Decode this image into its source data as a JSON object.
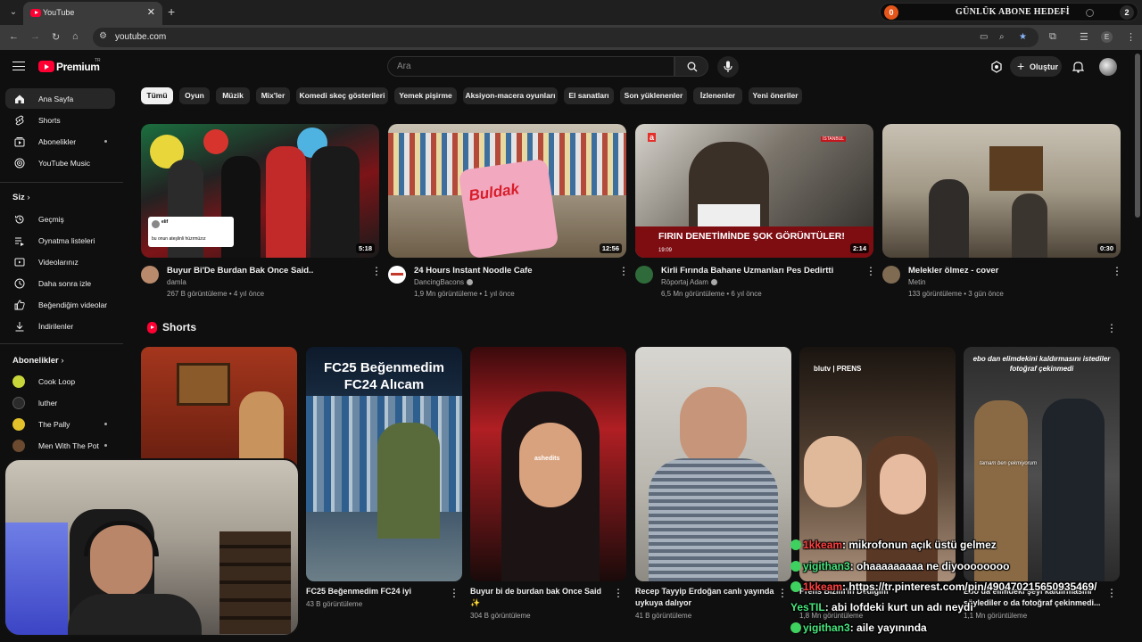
{
  "browser": {
    "tab_title": "YouTube",
    "url": "youtube.com",
    "profile_letter": "E"
  },
  "goal_widget": {
    "left_count": "0",
    "title": "GÜNLÜK ABONE HEDEFİ",
    "right_count": "2"
  },
  "header": {
    "brand": "Premium",
    "brand_sup": "TR",
    "search_placeholder": "Ara",
    "create_label": "Oluştur"
  },
  "sidebar": {
    "main": [
      {
        "label": "Ana Sayfa",
        "icon": "home-icon"
      },
      {
        "label": "Shorts",
        "icon": "shorts-icon"
      },
      {
        "label": "Abonelikler",
        "icon": "subscriptions-icon"
      },
      {
        "label": "YouTube Music",
        "icon": "music-icon"
      }
    ],
    "you_heading": "Siz",
    "you": [
      {
        "label": "Geçmiş",
        "icon": "history-icon"
      },
      {
        "label": "Oynatma listeleri",
        "icon": "playlists-icon"
      },
      {
        "label": "Videolarınız",
        "icon": "your-videos-icon"
      },
      {
        "label": "Daha sonra izle",
        "icon": "watch-later-icon"
      },
      {
        "label": "Beğendiğim videolar",
        "icon": "liked-icon"
      },
      {
        "label": "İndirilenler",
        "icon": "downloads-icon"
      }
    ],
    "subs_heading": "Abonelikler",
    "subs": [
      {
        "label": "Cook Loop",
        "color": "#c8d63a"
      },
      {
        "label": "luther",
        "color": "#2b2b2b"
      },
      {
        "label": "The Pally",
        "color": "#e2c12b"
      },
      {
        "label": "Men With The Pot",
        "color": "#6b4a2f"
      }
    ]
  },
  "chips": [
    "Tümü",
    "Oyun",
    "Müzik",
    "Mix'ler",
    "Komedi skeç gösterileri",
    "Yemek pişirme",
    "Aksiyon-macera oyunları",
    "El sanatları",
    "Son yüklenenler",
    "İzlenenler",
    "Yeni öneriler"
  ],
  "videos": [
    {
      "title": "Buyur Bi'De Burdan Bak Once Said..",
      "channel": "damla",
      "meta": "267 B görüntüleme • 4 yıl önce",
      "duration": "5:18",
      "overlay": "bu onun ateşlinli hüzrmüzız",
      "overlay_user": "elif"
    },
    {
      "title": "24 Hours Instant Noodle Cafe",
      "channel": "DancingBacons",
      "meta": "1,9 Mn görüntüleme • 1 yıl önce",
      "duration": "12:56",
      "overlay": "Buldak"
    },
    {
      "title": "Kirli Fırında Bahane Uzmanları Pes Dedirtti",
      "channel": "Röportaj Adam",
      "meta": "6,5 Mn görüntüleme • 6 yıl önce",
      "duration": "2:14",
      "overlay": "FIRIN DENETİMİNDE ŞOK GÖRÜNTÜLER!",
      "overlay_time": "19:09",
      "overlay_city": "İSTANBUL"
    },
    {
      "title": "Melekler ölmez - cover",
      "channel": "Metin",
      "meta": "133 görüntüleme • 3 gün önce",
      "duration": "0:30"
    }
  ],
  "shorts_heading": "Shorts",
  "shorts": [
    {
      "title": "",
      "meta": ""
    },
    {
      "title": "FC25 Beğenmedim FC24 iyi",
      "meta": "43 B görüntüleme",
      "overlay": "FC25 Beğenmedim FC24 Alıcam"
    },
    {
      "title": "Buyur bi de burdan bak Once Said ✨",
      "meta": "304 B görüntüleme",
      "overlay": "ashedits"
    },
    {
      "title": "Recep Tayyip Erdoğan canlı yayında uykuya dalıyor",
      "meta": "41 B görüntüleme"
    },
    {
      "title": "Prens Bizim'in Dediğim",
      "meta": "1,8 Mn görüntüleme",
      "overlay": "blutv | PRENS"
    },
    {
      "title": "Ebo da elimdeki şeyi kaldırmasını söylediler o da fotoğraf çekinmedi...",
      "meta": "1,1 Mn görüntüleme",
      "overlay": "ebo dan elimdekini kaldırmasını istediler fotoğraf çekinmedi",
      "overlay2": "tamam ben çekmiyorum"
    }
  ],
  "chat": [
    {
      "user": "1kkeam",
      "msg": ": mikrofonun açık üstü gelmez",
      "red": true
    },
    {
      "user": "yigithan3",
      "msg": ": ohaaaaaaaaa ne diyoooooooo",
      "red": false
    },
    {
      "user": "1kkeam",
      "msg": ": https://tr.pinterest.com/pin/490470215650935469/",
      "red": true
    },
    {
      "user": "YesTIL",
      "msg": ": abi Iofdeki kurt un adı neydi",
      "red": false
    },
    {
      "user": "yigithan3",
      "msg": ": aile yayınında",
      "red": false
    }
  ]
}
